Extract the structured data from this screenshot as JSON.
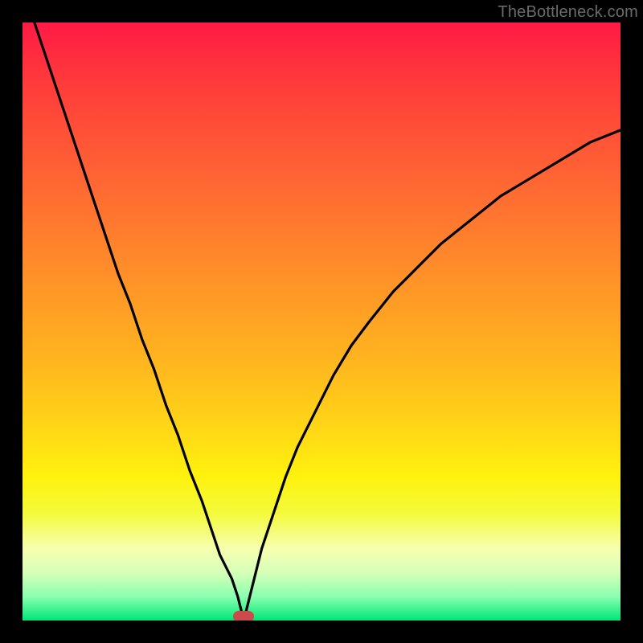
{
  "watermark": "TheBottleneck.com",
  "colors": {
    "frame": "#000000",
    "grad_top": "#ff1a45",
    "grad_mid": "#ffd716",
    "grad_bottom": "#00e676",
    "curve": "#000000",
    "marker": "#cc4a4a"
  },
  "chart_data": {
    "type": "line",
    "title": "",
    "xlabel": "",
    "ylabel": "",
    "xlim": [
      0,
      100
    ],
    "ylim": [
      0,
      100
    ],
    "annotations": [
      {
        "name": "optimal-marker",
        "x": 37,
        "y": 0
      }
    ],
    "series": [
      {
        "name": "bottleneck-curve",
        "x": [
          0,
          2,
          4,
          6,
          8,
          10,
          12,
          14,
          16,
          18,
          20,
          22,
          24,
          26,
          28,
          30,
          32,
          33,
          34,
          35,
          36,
          37,
          38,
          39,
          40,
          41,
          42,
          44,
          46,
          48,
          50,
          52,
          55,
          58,
          62,
          66,
          70,
          75,
          80,
          85,
          90,
          95,
          100
        ],
        "y": [
          106,
          100,
          94,
          88,
          82,
          76,
          70,
          64,
          58,
          53,
          47,
          42,
          36,
          31,
          25,
          20,
          14,
          11,
          9,
          7,
          4,
          0,
          4,
          8,
          12,
          15,
          18,
          24,
          29,
          33,
          37,
          41,
          46,
          50,
          55,
          59,
          63,
          67,
          71,
          74,
          77,
          80,
          82
        ]
      }
    ]
  }
}
